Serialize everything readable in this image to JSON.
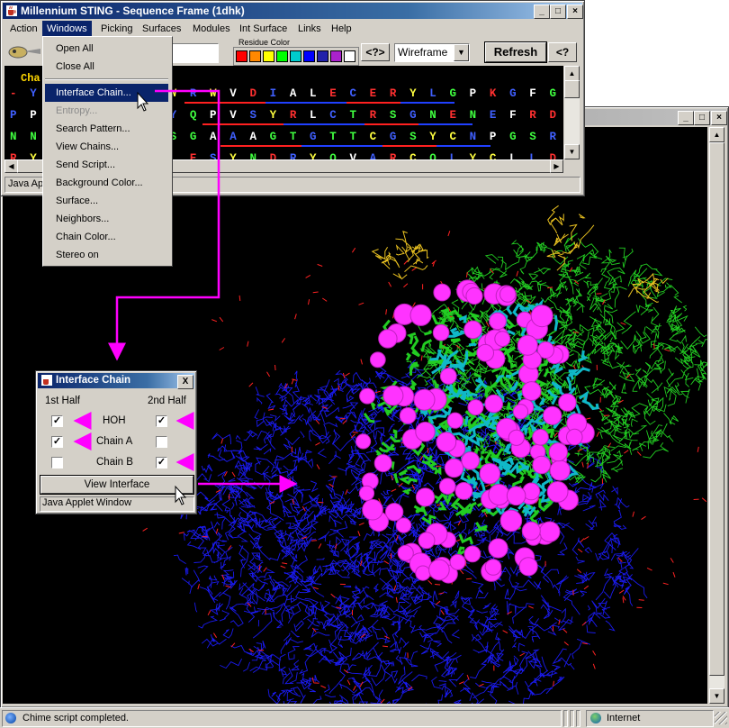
{
  "main_window": {
    "title": "Millennium STING - Sequence Frame (1dhk)",
    "menus": [
      "Action",
      "Windows",
      "Picking",
      "Surfaces",
      "Modules",
      "Int Surface",
      "Links",
      "Help"
    ],
    "active_menu": "Windows",
    "residue_color_label": "Residue Color",
    "swatches": [
      "#ff0000",
      "#ff8800",
      "#ffff00",
      "#00ff00",
      "#00cccc",
      "#0000ff",
      "#2222aa",
      "#aa22cc",
      "#ffffff"
    ],
    "help_button": "<?>",
    "render_mode": "Wireframe",
    "refresh_label": "Refresh",
    "help_button2": "<?",
    "status_text": "Java Applet Window",
    "chain_label": "Cha"
  },
  "windows_menu": {
    "items": [
      {
        "label": "Open All",
        "state": "normal"
      },
      {
        "label": "Close All",
        "state": "normal"
      },
      {
        "label": "Interface Chain...",
        "state": "highlighted"
      },
      {
        "label": "Entropy...",
        "state": "disabled"
      },
      {
        "label": "Search Pattern...",
        "state": "normal"
      },
      {
        "label": "View Chains...",
        "state": "normal"
      },
      {
        "label": "Send Script...",
        "state": "normal"
      },
      {
        "label": "Background Color...",
        "state": "normal"
      },
      {
        "label": "Surface...",
        "state": "normal"
      },
      {
        "label": "Neighbors...",
        "state": "normal"
      },
      {
        "label": "Chain Color...",
        "state": "normal"
      },
      {
        "label": "Stereo on",
        "state": "normal"
      }
    ]
  },
  "sequence": {
    "lines": [
      "- Y A             V H L F E W R W V D I A L E C E R Y L G P K G F G G V Q V S",
      "P P N             P W W E R Y Q P V S Y R L C T R S G N E N E F R D M V T A C",
      "N N V             N H M C G S G A A A G T G T T C G S Y C N P G S R E F P A V",
      "R Y S             T A S G G L E S Y N D R Y Q V A R C Q L Y C L L D L A E P"
    ]
  },
  "interface_chain_dialog": {
    "title": "Interface Chain",
    "col1": "1st Half",
    "col2": "2nd Half",
    "rows": [
      {
        "label": "HOH",
        "first": true,
        "second": true
      },
      {
        "label": "Chain A",
        "first": true,
        "second": false
      },
      {
        "label": "Chain B",
        "first": false,
        "second": true
      }
    ],
    "button": "View Interface",
    "status": "Java Applet Window",
    "close": "X"
  },
  "browser": {
    "status": "Chime script completed.",
    "zone": "Internet"
  },
  "colors": {
    "title_active": "#0a246a",
    "annotation_arrow": "#ff00ff",
    "chain_a": "#22cc22",
    "chain_b": "#1a1aee",
    "interface_atoms": "#ff33ff",
    "interface_residues": "#10b8c8",
    "water": "#ff2222",
    "ligand": "#e8c020"
  }
}
